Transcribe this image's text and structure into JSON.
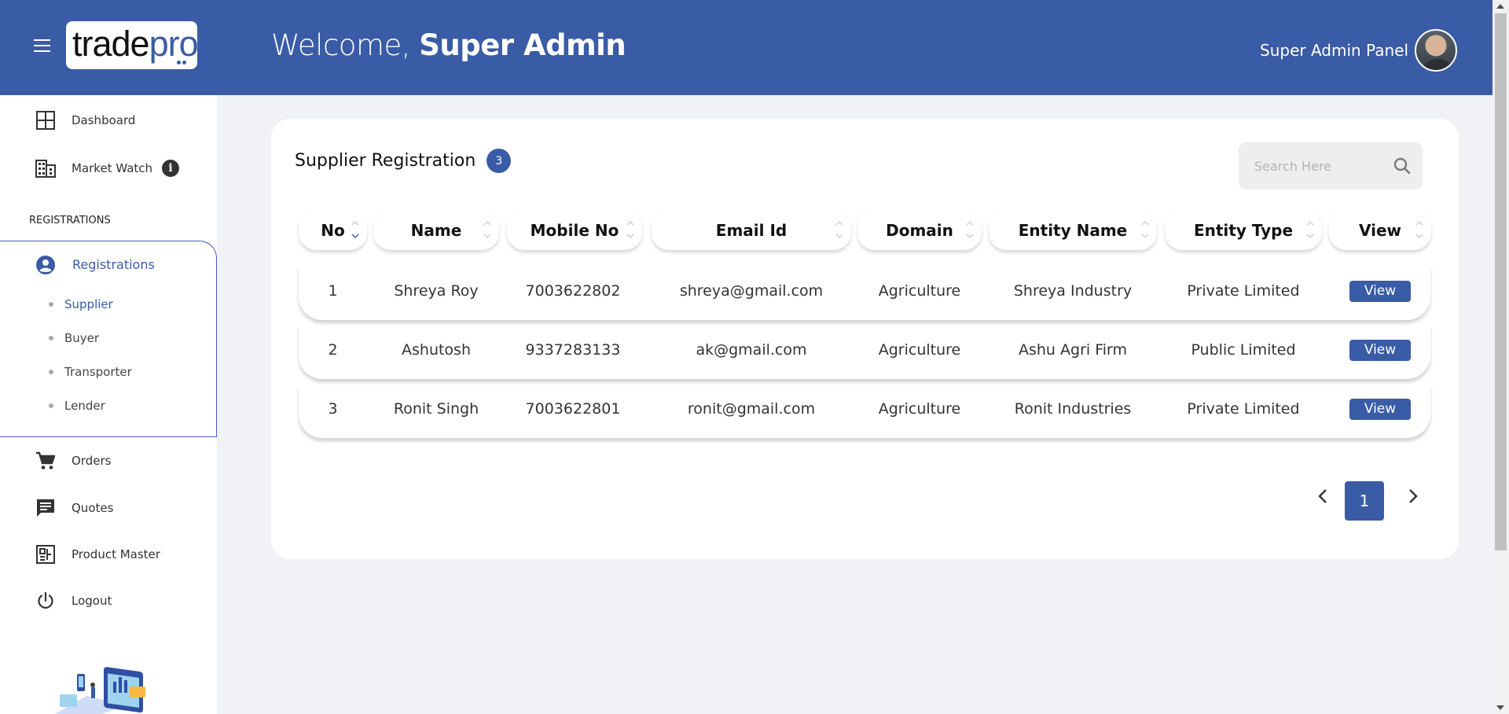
{
  "header": {
    "logo_main": "trade",
    "logo_accent": "pro",
    "welcome_prefix": "Welcome, ",
    "welcome_name": "Super Admin",
    "panel_label": "Super Admin Panel"
  },
  "sidebar": {
    "dashboard": "Dashboard",
    "market_watch": "Market Watch",
    "info_icon": "i",
    "section_registrations": "REGISTRATIONS",
    "registrations": "Registrations",
    "sub_items": [
      "Supplier",
      "Buyer",
      "Transporter",
      "Lender"
    ],
    "orders": "Orders",
    "quotes": "Quotes",
    "product_master": "Product Master",
    "logout": "Logout"
  },
  "main": {
    "title": "Supplier Registration",
    "count": "3",
    "search_placeholder": "Search Here",
    "columns": [
      "No",
      "Name",
      "Mobile No",
      "Email Id",
      "Domain",
      "Entity Name",
      "Entity Type",
      "View"
    ],
    "rows": [
      {
        "no": "1",
        "name": "Shreya Roy",
        "mobile": "7003622802",
        "email": "shreya@gmail.com",
        "domain": "Agriculture",
        "entity_name": "Shreya Industry",
        "entity_type": "Private Limited",
        "view": "View"
      },
      {
        "no": "2",
        "name": "Ashutosh",
        "mobile": "9337283133",
        "email": "ak@gmail.com",
        "domain": "Agriculture",
        "entity_name": "Ashu Agri Firm",
        "entity_type": "Public Limited",
        "view": "View"
      },
      {
        "no": "3",
        "name": "Ronit Singh",
        "mobile": "7003622801",
        "email": "ronit@gmail.com",
        "domain": "Agriculture",
        "entity_name": "Ronit Industries",
        "entity_type": "Private Limited",
        "view": "View"
      }
    ],
    "pagination": {
      "current_page": "1"
    }
  },
  "colors": {
    "primary": "#3a5ba5",
    "background": "#f1f2f5",
    "card": "#ffffff",
    "sidebar_active_border": "#4a56c8"
  }
}
